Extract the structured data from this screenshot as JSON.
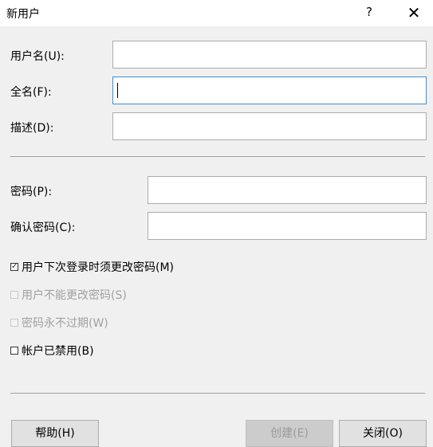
{
  "window": {
    "title": "新用户",
    "help_glyph": "?",
    "close_glyph": "✕"
  },
  "fields": {
    "username": {
      "label": "用户名(U):",
      "value": ""
    },
    "fullname": {
      "label": "全名(F):",
      "value": ""
    },
    "description": {
      "label": "描述(D):",
      "value": ""
    },
    "password": {
      "label": "密码(P):",
      "value": ""
    },
    "confirm_password": {
      "label": "确认密码(C):",
      "value": ""
    }
  },
  "checkboxes": [
    {
      "label": "用户下次登录时须更改密码(M)",
      "checked": true,
      "enabled": true
    },
    {
      "label": "用户不能更改密码(S)",
      "checked": false,
      "enabled": false
    },
    {
      "label": "密码永不过期(W)",
      "checked": false,
      "enabled": false
    },
    {
      "label": "帐户已禁用(B)",
      "checked": false,
      "enabled": true
    }
  ],
  "buttons": {
    "help": "帮助(H)",
    "create": "创建(E)",
    "close": "关闭(O)"
  }
}
